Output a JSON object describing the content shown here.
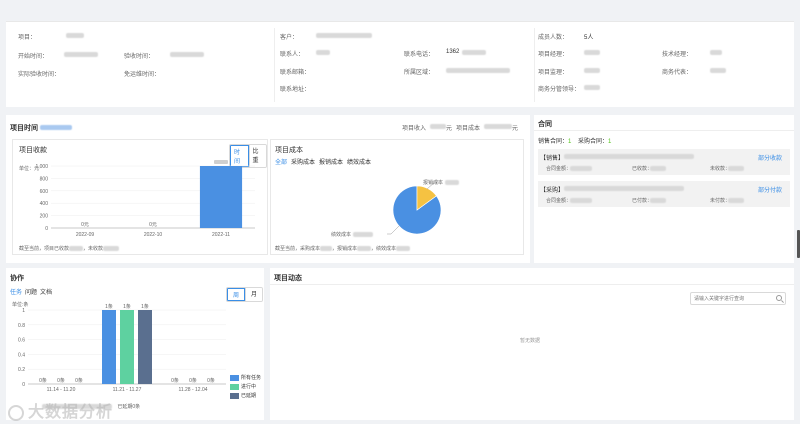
{
  "info": {
    "project_label": "项目：",
    "start_label": "开始时间：",
    "accept_label": "验收时间：",
    "actual_accept_label": "实际验收时间：",
    "warranty_label": "免运维时间：",
    "customer_label": "客户：",
    "contact_label": "联系人：",
    "phone_label": "联系电话：",
    "phone_value": "1362",
    "email_label": "联系邮箱：",
    "region_label": "所属区域：",
    "address_label": "联系地址：",
    "members_label": "成员人数：",
    "members_value": "5人",
    "pm_label": "项目经理：",
    "tech_label": "技术经理：",
    "supervisor_label": "项目监理：",
    "biz_label": "商务代表：",
    "biz_leader_label": "商务分管领导："
  },
  "timeline": {
    "title": "项目时间",
    "income_label": "项目收入",
    "income_unit": "元",
    "cost_label": "项目成本",
    "cost_unit": "元"
  },
  "receipt": {
    "title": "项目收款",
    "tab_time": "时间",
    "tab_ratio": "比重",
    "unit_label": "单位：元",
    "footer_prefix": "截至当前，项目已收款",
    "footer_mid": "，未收款",
    "chart_data": {
      "type": "bar",
      "categories": [
        "2022-09",
        "2022-10",
        "2022-11"
      ],
      "values": [
        0,
        0,
        1000
      ],
      "value_labels": [
        "0元",
        "0元",
        ""
      ],
      "ylim": [
        0,
        1000
      ],
      "yticks": [
        "0",
        "200",
        "400",
        "600",
        "800",
        "1,000"
      ],
      "bar_color": "#4a90e2"
    }
  },
  "cost": {
    "title": "项目成本",
    "tabs": [
      "全部",
      "采购成本",
      "报销成本",
      "绩效成本"
    ],
    "label_reimburse": "报销成本",
    "label_perf": "绩效成本",
    "footer_prefix": "截至当前，采购成本",
    "footer_mid1": "，报销成本",
    "footer_mid2": "，绩效成本",
    "chart_data": {
      "type": "pie",
      "slices": [
        {
          "name": "绩效成本",
          "value": 85,
          "color": "#4a90e2"
        },
        {
          "name": "报销成本",
          "value": 15,
          "color": "#f5c242"
        }
      ]
    }
  },
  "contract": {
    "title": "合同",
    "sales_label": "销售合同：",
    "sales_count": "1",
    "purchase_label": "采购合同：",
    "purchase_count": "1",
    "items": [
      {
        "tag": "【销售】",
        "link": "部分收款",
        "f1": "合同金额：",
        "f2": "已收款：",
        "f3": "未收款："
      },
      {
        "tag": "【采购】",
        "link": "部分付款",
        "f1": "合同金额：",
        "f2": "已付款：",
        "f3": "未付款："
      }
    ]
  },
  "collab": {
    "title": "协作",
    "tabs": [
      "任务",
      "问题",
      "文档"
    ],
    "view_week": "周",
    "view_month": "月",
    "unit_label": "单位:条",
    "footer_text": "已延期0条",
    "chart_data": {
      "type": "bar",
      "categories": [
        "11.14 - 11.20",
        "11.21 - 11.27",
        "11.28 - 12.04"
      ],
      "series": [
        {
          "name": "所有任务",
          "color": "#4a90e2",
          "values": [
            0,
            1,
            0
          ]
        },
        {
          "name": "进行中",
          "color": "#5ed1a0",
          "values": [
            0,
            1,
            0
          ]
        },
        {
          "name": "已延期",
          "color": "#5a6f8f",
          "values": [
            0,
            1,
            0
          ]
        }
      ],
      "value_labels": [
        [
          "0条",
          "1条",
          "0条"
        ],
        [
          "0条",
          "1条",
          "0条"
        ],
        [
          "0条",
          "1条",
          "0条"
        ]
      ],
      "ylim": [
        0,
        1
      ],
      "yticks": [
        "0",
        "0.2",
        "0.4",
        "0.6",
        "0.8",
        "1"
      ]
    }
  },
  "dynamics": {
    "title": "项目动态",
    "search_placeholder": "请输入关键字进行查询",
    "empty_text": "暂无数据"
  },
  "watermark": {
    "text": "大数据分析"
  }
}
